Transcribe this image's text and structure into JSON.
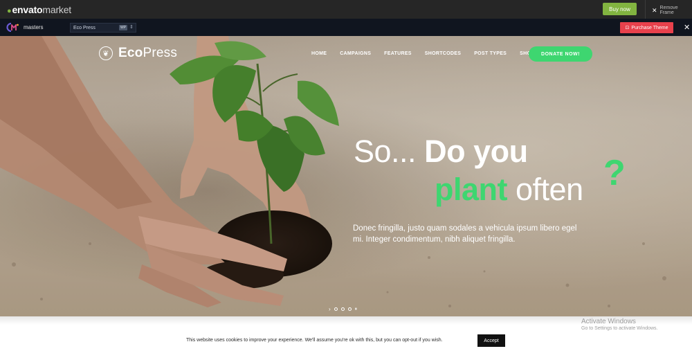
{
  "envato": {
    "logo_envato": "envato",
    "logo_market": "market",
    "buy_now": "Buy now",
    "remove_frame": "Remove Frame"
  },
  "masters": {
    "label": "masters",
    "theme_selected": "Eco Press",
    "purchase_label": "Purchase Theme"
  },
  "site": {
    "logo_bold": "Eco",
    "logo_light": "Press",
    "nav": [
      "HOME",
      "CAMPAIGNS",
      "FEATURES",
      "SHORTCODES",
      "POST TYPES",
      "SHOP"
    ],
    "donate": "DONATE NOW!"
  },
  "hero": {
    "line1_light": "So...",
    "line1_bold": "Do you",
    "line2_green": "plant",
    "line2_light": "often",
    "question": "?",
    "paragraph": "Donec fringilla, justo quam sodales a vehicula ipsum libero egel mi. Integer condimentum, nibh aliquet fringilla."
  },
  "windows": {
    "activate_title": "Activate Windows",
    "activate_sub": "Go to Settings to activate Windows."
  },
  "cookie": {
    "text": "This website uses cookies to improve your experience. We'll assume you're ok with this, but you can opt-out if you wish.",
    "accept": "Accept"
  },
  "colors": {
    "brand_green": "#3ed670",
    "envato_green": "#82b440",
    "purchase_red": "#e8414c",
    "masters_bg": "#10151f"
  }
}
